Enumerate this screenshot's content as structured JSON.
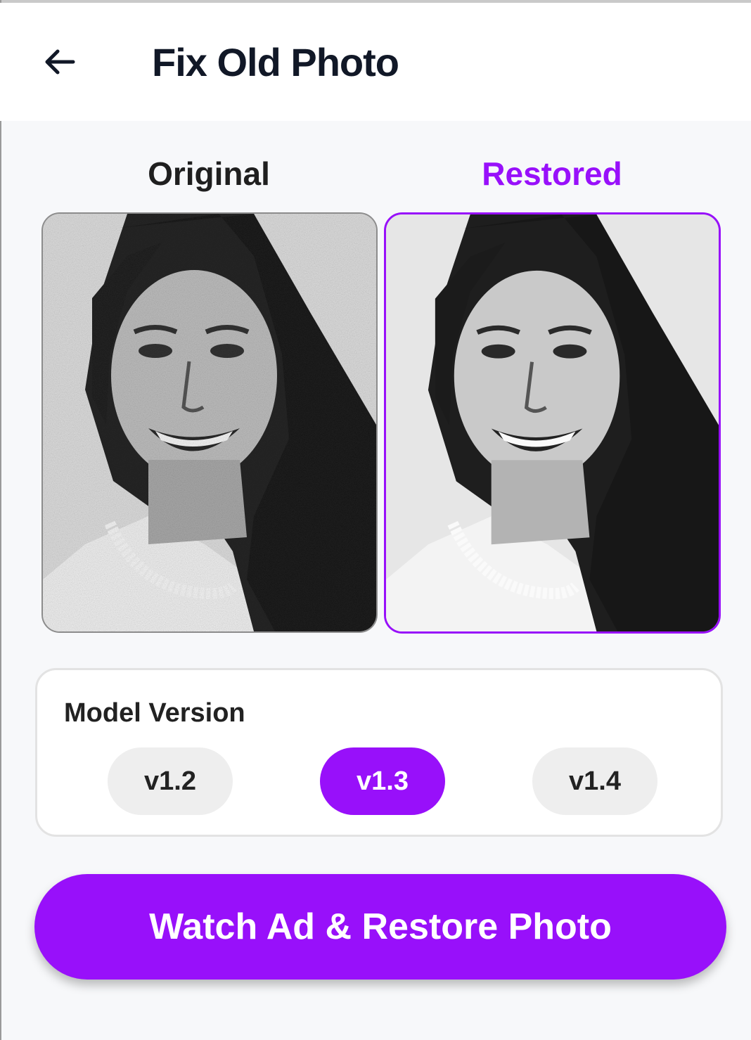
{
  "header": {
    "title": "Fix Old Photo",
    "back_icon": "arrow-left-icon"
  },
  "comparison": {
    "original_label": "Original",
    "restored_label": "Restored"
  },
  "model": {
    "title": "Model Version",
    "versions": [
      "v1.2",
      "v1.3",
      "v1.4"
    ],
    "selected": "v1.3"
  },
  "cta": {
    "label": "Watch Ad & Restore Photo"
  },
  "colors": {
    "accent": "#9810fa",
    "title": "#111827"
  }
}
